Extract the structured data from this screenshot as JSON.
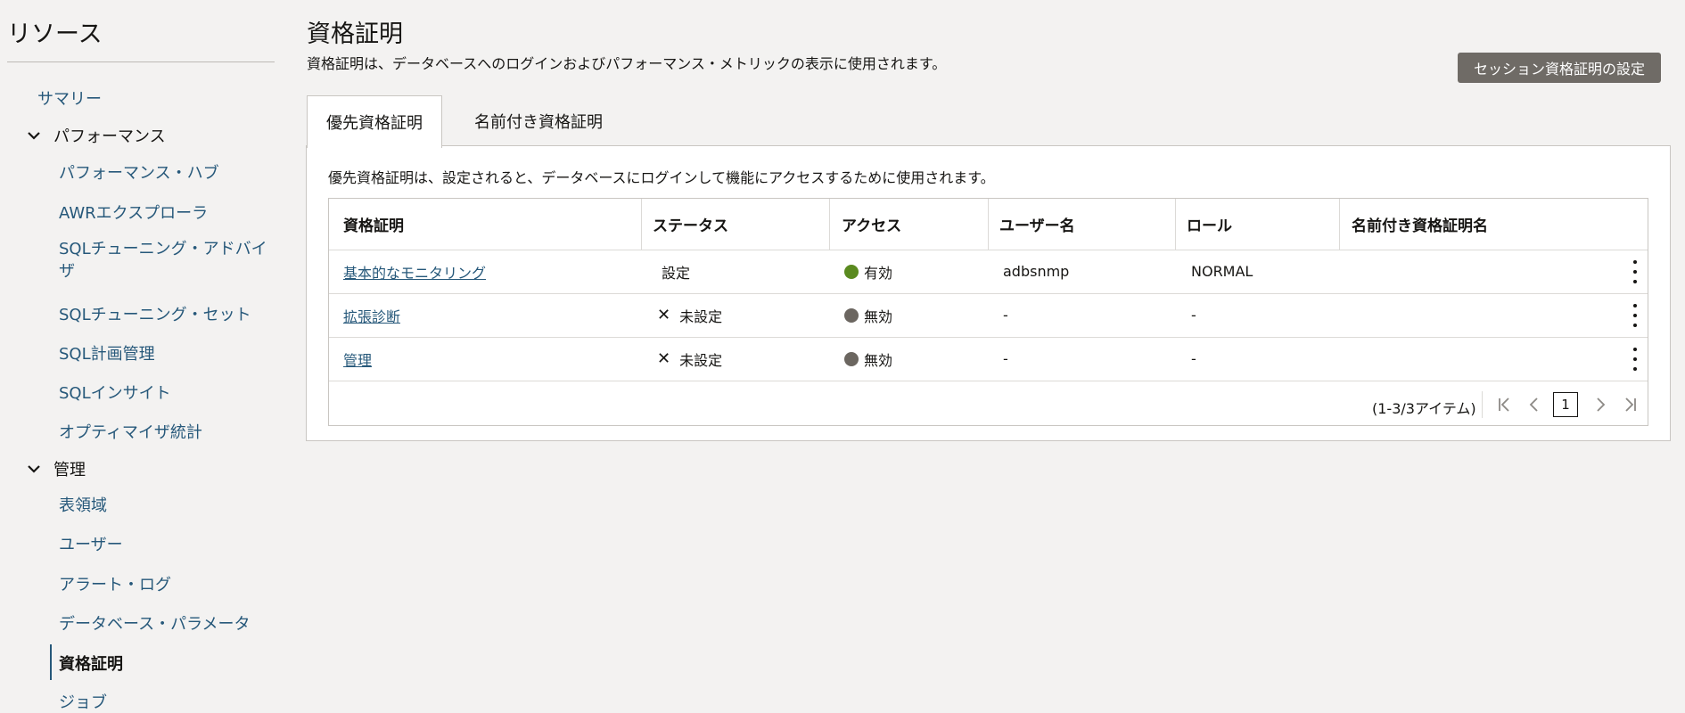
{
  "sidebar": {
    "title": "リソース",
    "summary": "サマリー",
    "groups": {
      "performance": "パフォーマンス",
      "management": "管理"
    },
    "items": {
      "perf_hub": "パフォーマンス・ハブ",
      "awr": "AWRエクスプローラ",
      "sql_tuning_advisor": "SQLチューニング・アドバイザ",
      "sql_tuning_set": "SQLチューニング・セット",
      "sql_plan": "SQL計画管理",
      "sql_insight": "SQLインサイト",
      "optimizer_stats": "オプティマイザ統計",
      "tablespaces": "表領域",
      "users": "ユーザー",
      "alert_log": "アラート・ログ",
      "db_params": "データベース・パラメータ",
      "credentials": "資格証明",
      "jobs": "ジョブ"
    }
  },
  "header": {
    "title": "資格証明",
    "description": "資格証明は、データベースへのログインおよびパフォーマンス・メトリックの表示に使用されます。",
    "session_button": "セッション資格証明の設定"
  },
  "tabs": [
    {
      "label": "優先資格証明",
      "active": true
    },
    {
      "label": "名前付き資格証明",
      "active": false
    }
  ],
  "panel": {
    "description": "優先資格証明は、設定されると、データベースにログインして機能にアクセスするために使用されます。"
  },
  "table": {
    "columns": [
      "資格証明",
      "ステータス",
      "アクセス",
      "ユーザー名",
      "ロール",
      "名前付き資格証明名"
    ],
    "rows": [
      {
        "credential": "基本的なモニタリング",
        "status": "設定",
        "status_icon": "none",
        "access": "有効",
        "access_color": "#5a8a1f",
        "username": "adbsnmp",
        "role": "NORMAL",
        "named": ""
      },
      {
        "credential": "拡張診断",
        "status": "未設定",
        "status_icon": "x-icon",
        "access": "無効",
        "access_color": "#6b6660",
        "username": "-",
        "role": "-",
        "named": ""
      },
      {
        "credential": "管理",
        "status": "未設定",
        "status_icon": "x-icon",
        "access": "無効",
        "access_color": "#6b6660",
        "username": "-",
        "role": "-",
        "named": ""
      }
    ]
  },
  "pagination": {
    "count": "(1-3/3アイテム)",
    "current_page": "1"
  }
}
